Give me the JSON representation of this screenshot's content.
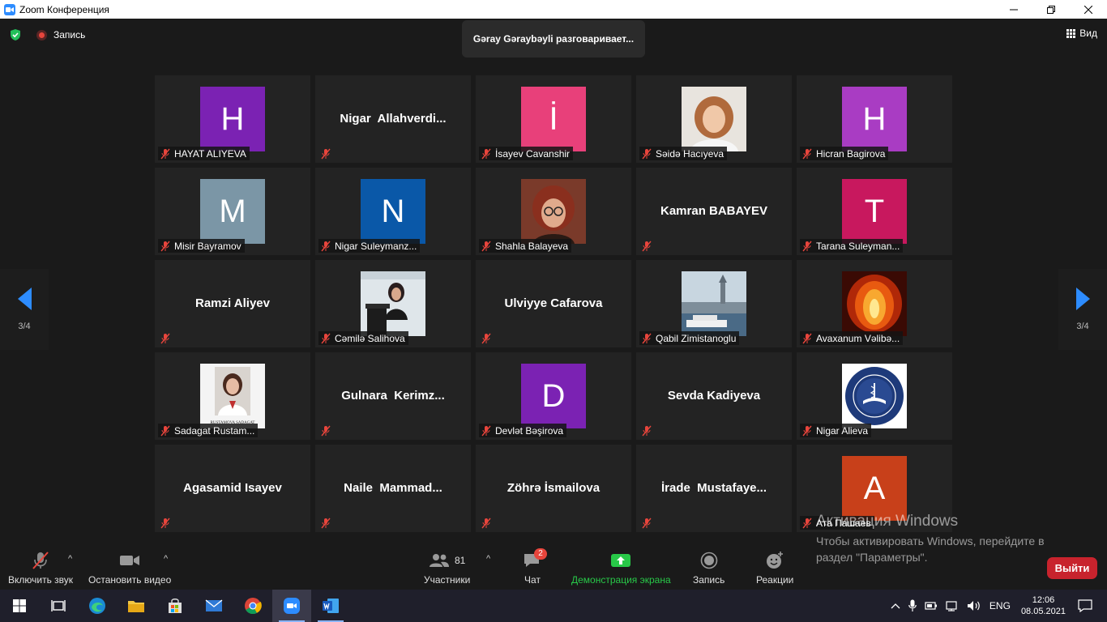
{
  "window": {
    "title": "Zoom Конференция",
    "controls": [
      "minimize-icon",
      "restore-icon",
      "close-icon"
    ]
  },
  "topbar": {
    "recording_label": "Запись",
    "speaking_banner": "Gəray Gəraybəyli разговаривает...",
    "view_label": "Вид",
    "colors": {
      "secure": "#23c05a",
      "record": "#e8453c"
    }
  },
  "pagination": {
    "left_label": "3/4",
    "right_label": "3/4",
    "arrow_color": "#2d8cff"
  },
  "participants": [
    {
      "name": "HAYAT ALIYEVA",
      "initial": "H",
      "color": "#7b22b3"
    },
    {
      "name": "",
      "bigname": "Nigar  Allahverdi..."
    },
    {
      "name": "İsayev Cavanshir",
      "initial": "İ",
      "color": "#e8407a"
    },
    {
      "name": "Səidə Hacıyeva",
      "photo": "woman-portrait"
    },
    {
      "name": "Hicran Bagirova",
      "initial": "H",
      "color": "#a93cc3"
    },
    {
      "name": "Misir Bayramov",
      "initial": "M",
      "color": "#7b96a6"
    },
    {
      "name": "Nigar Suleymanz...",
      "initial": "N",
      "color": "#0a58a8"
    },
    {
      "name": "Shahla Balayeva",
      "photo": "woman-glasses"
    },
    {
      "name": "",
      "bigname": "Kamran BABAYEV"
    },
    {
      "name": "Tarana Suleyman...",
      "initial": "T",
      "color": "#c8185e"
    },
    {
      "name": "",
      "bigname": "Ramzi Aliyev"
    },
    {
      "name": "Cəmilə Salihova",
      "photo": "speaker-podium"
    },
    {
      "name": "",
      "bigname": "Ulviyye Cafarova"
    },
    {
      "name": "Qabil Zimistanoglu",
      "photo": "istanbul-skyline"
    },
    {
      "name": "Avaxanum Vəlibə...",
      "photo": "fire-phoenix"
    },
    {
      "name": "Sadagat Rustam...",
      "photo": "id-photo",
      "photo_caption": "RUSTAMOVA SADAGAT"
    },
    {
      "name": "",
      "bigname": "Gulnara  Kerimz..."
    },
    {
      "name": "Devlət Bəşirova",
      "initial": "D",
      "color": "#7b22b3"
    },
    {
      "name": "",
      "bigname": "Sevda Kadiyeva"
    },
    {
      "name": "Nigar Alieva",
      "photo": "university-seal"
    },
    {
      "name": "",
      "bigname": "Agasamid Isayev"
    },
    {
      "name": "",
      "bigname": "Naile  Mammad..."
    },
    {
      "name": "",
      "bigname": "Zöhrə İsmailova"
    },
    {
      "name": "",
      "bigname": "İrade  Mustafaye..."
    },
    {
      "name": "Ата Пашаев",
      "initial": "A",
      "color": "#c8401a"
    }
  ],
  "toolbar": {
    "unmute_label": "Включить звук",
    "stop_video_label": "Остановить видео",
    "participants_label": "Участники",
    "participants_count": "81",
    "chat_label": "Чат",
    "chat_badge": "2",
    "share_label": "Демонстрация экрана",
    "record_label": "Запись",
    "reactions_label": "Реакции",
    "leave_label": "Выйти",
    "share_color": "#28c848",
    "leave_color": "#c8232d"
  },
  "activation": {
    "title": "Активация Windows",
    "body": "Чтобы активировать Windows, перейдите в раздел \"Параметры\"."
  },
  "taskbar": {
    "apps": [
      "windows-start-icon",
      "task-view-icon",
      "edge-icon",
      "file-explorer-icon",
      "store-icon",
      "mail-icon",
      "chrome-icon",
      "zoom-icon",
      "word-icon"
    ],
    "language": "ENG",
    "time": "12:06",
    "date": "08.05.2021"
  }
}
